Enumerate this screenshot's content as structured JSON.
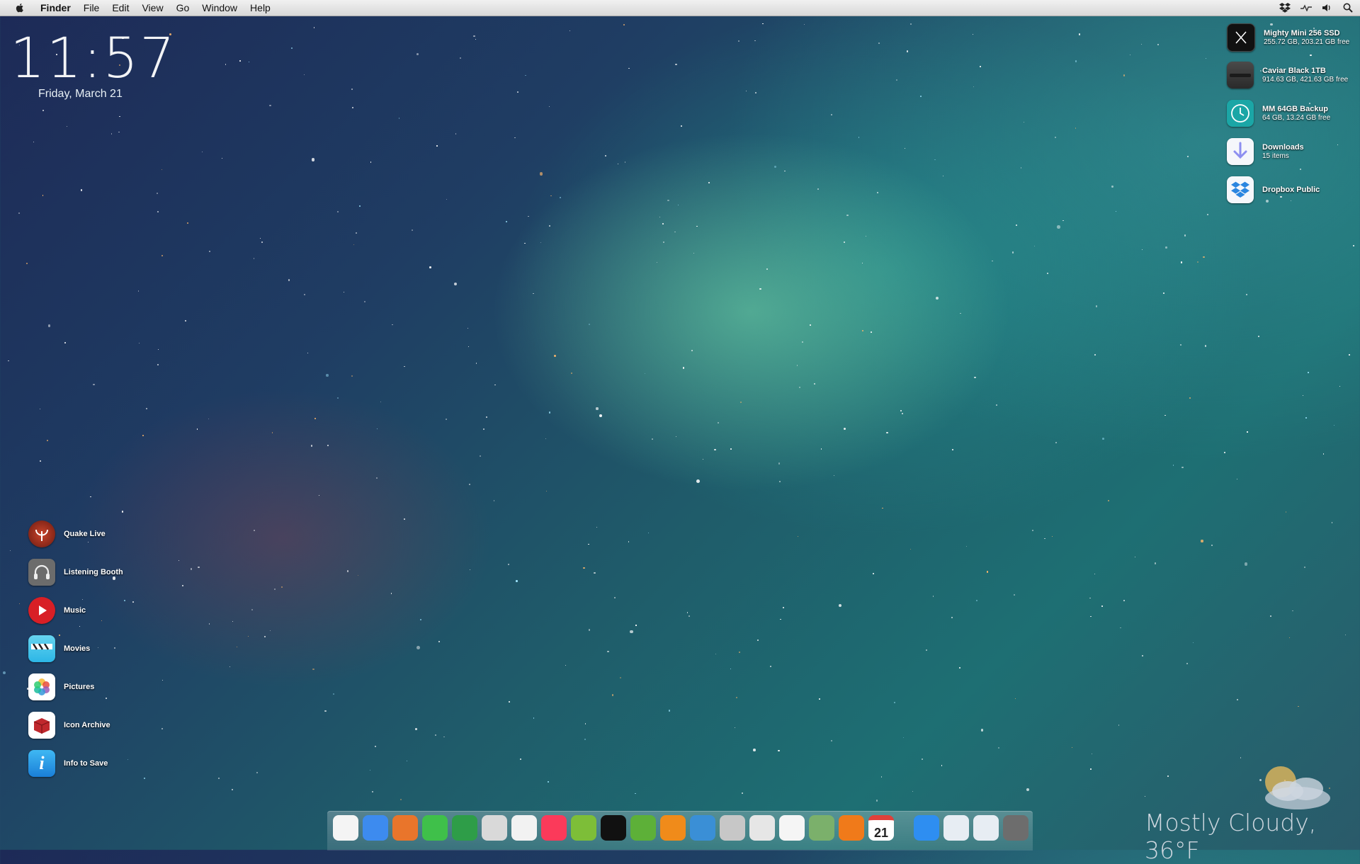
{
  "menubar": {
    "app_name": "Finder",
    "menus": [
      "File",
      "Edit",
      "View",
      "Go",
      "Window",
      "Help"
    ],
    "status_icons": [
      "dropbox-icon",
      "activity-icon",
      "volume-icon",
      "spotlight-icon"
    ]
  },
  "clock": {
    "time": "11:57",
    "date": "Friday, March 21"
  },
  "drives": [
    {
      "name": "Mighty Mini 256 SSD",
      "detail": "255.72 GB, 203.21 GB free",
      "icon": "ssd-icon"
    },
    {
      "name": "Caviar Black 1TB",
      "detail": "914.63 GB, 421.63 GB free",
      "icon": "hard-drive-icon"
    },
    {
      "name": "MM 64GB Backup",
      "detail": "64 GB, 13.24 GB free",
      "icon": "time-machine-icon"
    },
    {
      "name": "Downloads",
      "detail": "15 items",
      "icon": "downloads-icon"
    },
    {
      "name": "Dropbox Public",
      "detail": "",
      "icon": "dropbox-folder-icon"
    }
  ],
  "shortcuts": [
    {
      "name": "Quake Live",
      "icon": "quake-icon"
    },
    {
      "name": "Listening Booth",
      "icon": "headphones-icon"
    },
    {
      "name": "Music",
      "icon": "play-icon"
    },
    {
      "name": "Movies",
      "icon": "clapperboard-icon"
    },
    {
      "name": "Pictures",
      "icon": "photos-icon"
    },
    {
      "name": "Icon Archive",
      "icon": "archive-icon"
    },
    {
      "name": "Info to Save",
      "icon": "info-icon"
    }
  ],
  "weather": {
    "text": "Mostly Cloudy, 36°F",
    "icon": "partly-cloudy-icon"
  },
  "dock": {
    "calendar_day": "21",
    "apps": [
      {
        "icon": "xcode-icon",
        "color": "#f4f4f4"
      },
      {
        "icon": "mail-icon",
        "color": "#3d8bef"
      },
      {
        "icon": "firefox-icon",
        "color": "#e9752b"
      },
      {
        "icon": "messages-icon",
        "color": "#3fc04a"
      },
      {
        "icon": "sync-icon",
        "color": "#2e9d48"
      },
      {
        "icon": "lifebuoy-icon",
        "color": "#d9d9d9"
      },
      {
        "icon": "magnet-icon",
        "color": "#f2f2f2"
      },
      {
        "icon": "itunes-icon",
        "color": "#fb3a5a"
      },
      {
        "icon": "spotify-icon",
        "color": "#7dbe38"
      },
      {
        "icon": "speaker-icon",
        "color": "#111111"
      },
      {
        "icon": "search-icon",
        "color": "#5db038"
      },
      {
        "icon": "vlc-icon",
        "color": "#f08b1a"
      },
      {
        "icon": "photo-booth-icon",
        "color": "#3a8fd6"
      },
      {
        "icon": "camera-icon",
        "color": "#c7c7c7"
      },
      {
        "icon": "aperture-icon",
        "color": "#e6e6e6"
      },
      {
        "icon": "crossover-icon",
        "color": "#f5f5f5"
      },
      {
        "icon": "frogger-icon",
        "color": "#7bb06b"
      },
      {
        "icon": "pages-icon",
        "color": "#f07a1a"
      },
      {
        "icon": "calendar-icon",
        "color": "#ffffff"
      },
      {
        "icon": "app-store-icon",
        "color": "#2e8ef1"
      },
      {
        "icon": "window-icon",
        "color": "#e7edf3"
      },
      {
        "icon": "window-icon-2",
        "color": "#e7edf3"
      },
      {
        "icon": "trash-icon",
        "color": "#6d6d6d"
      }
    ]
  }
}
